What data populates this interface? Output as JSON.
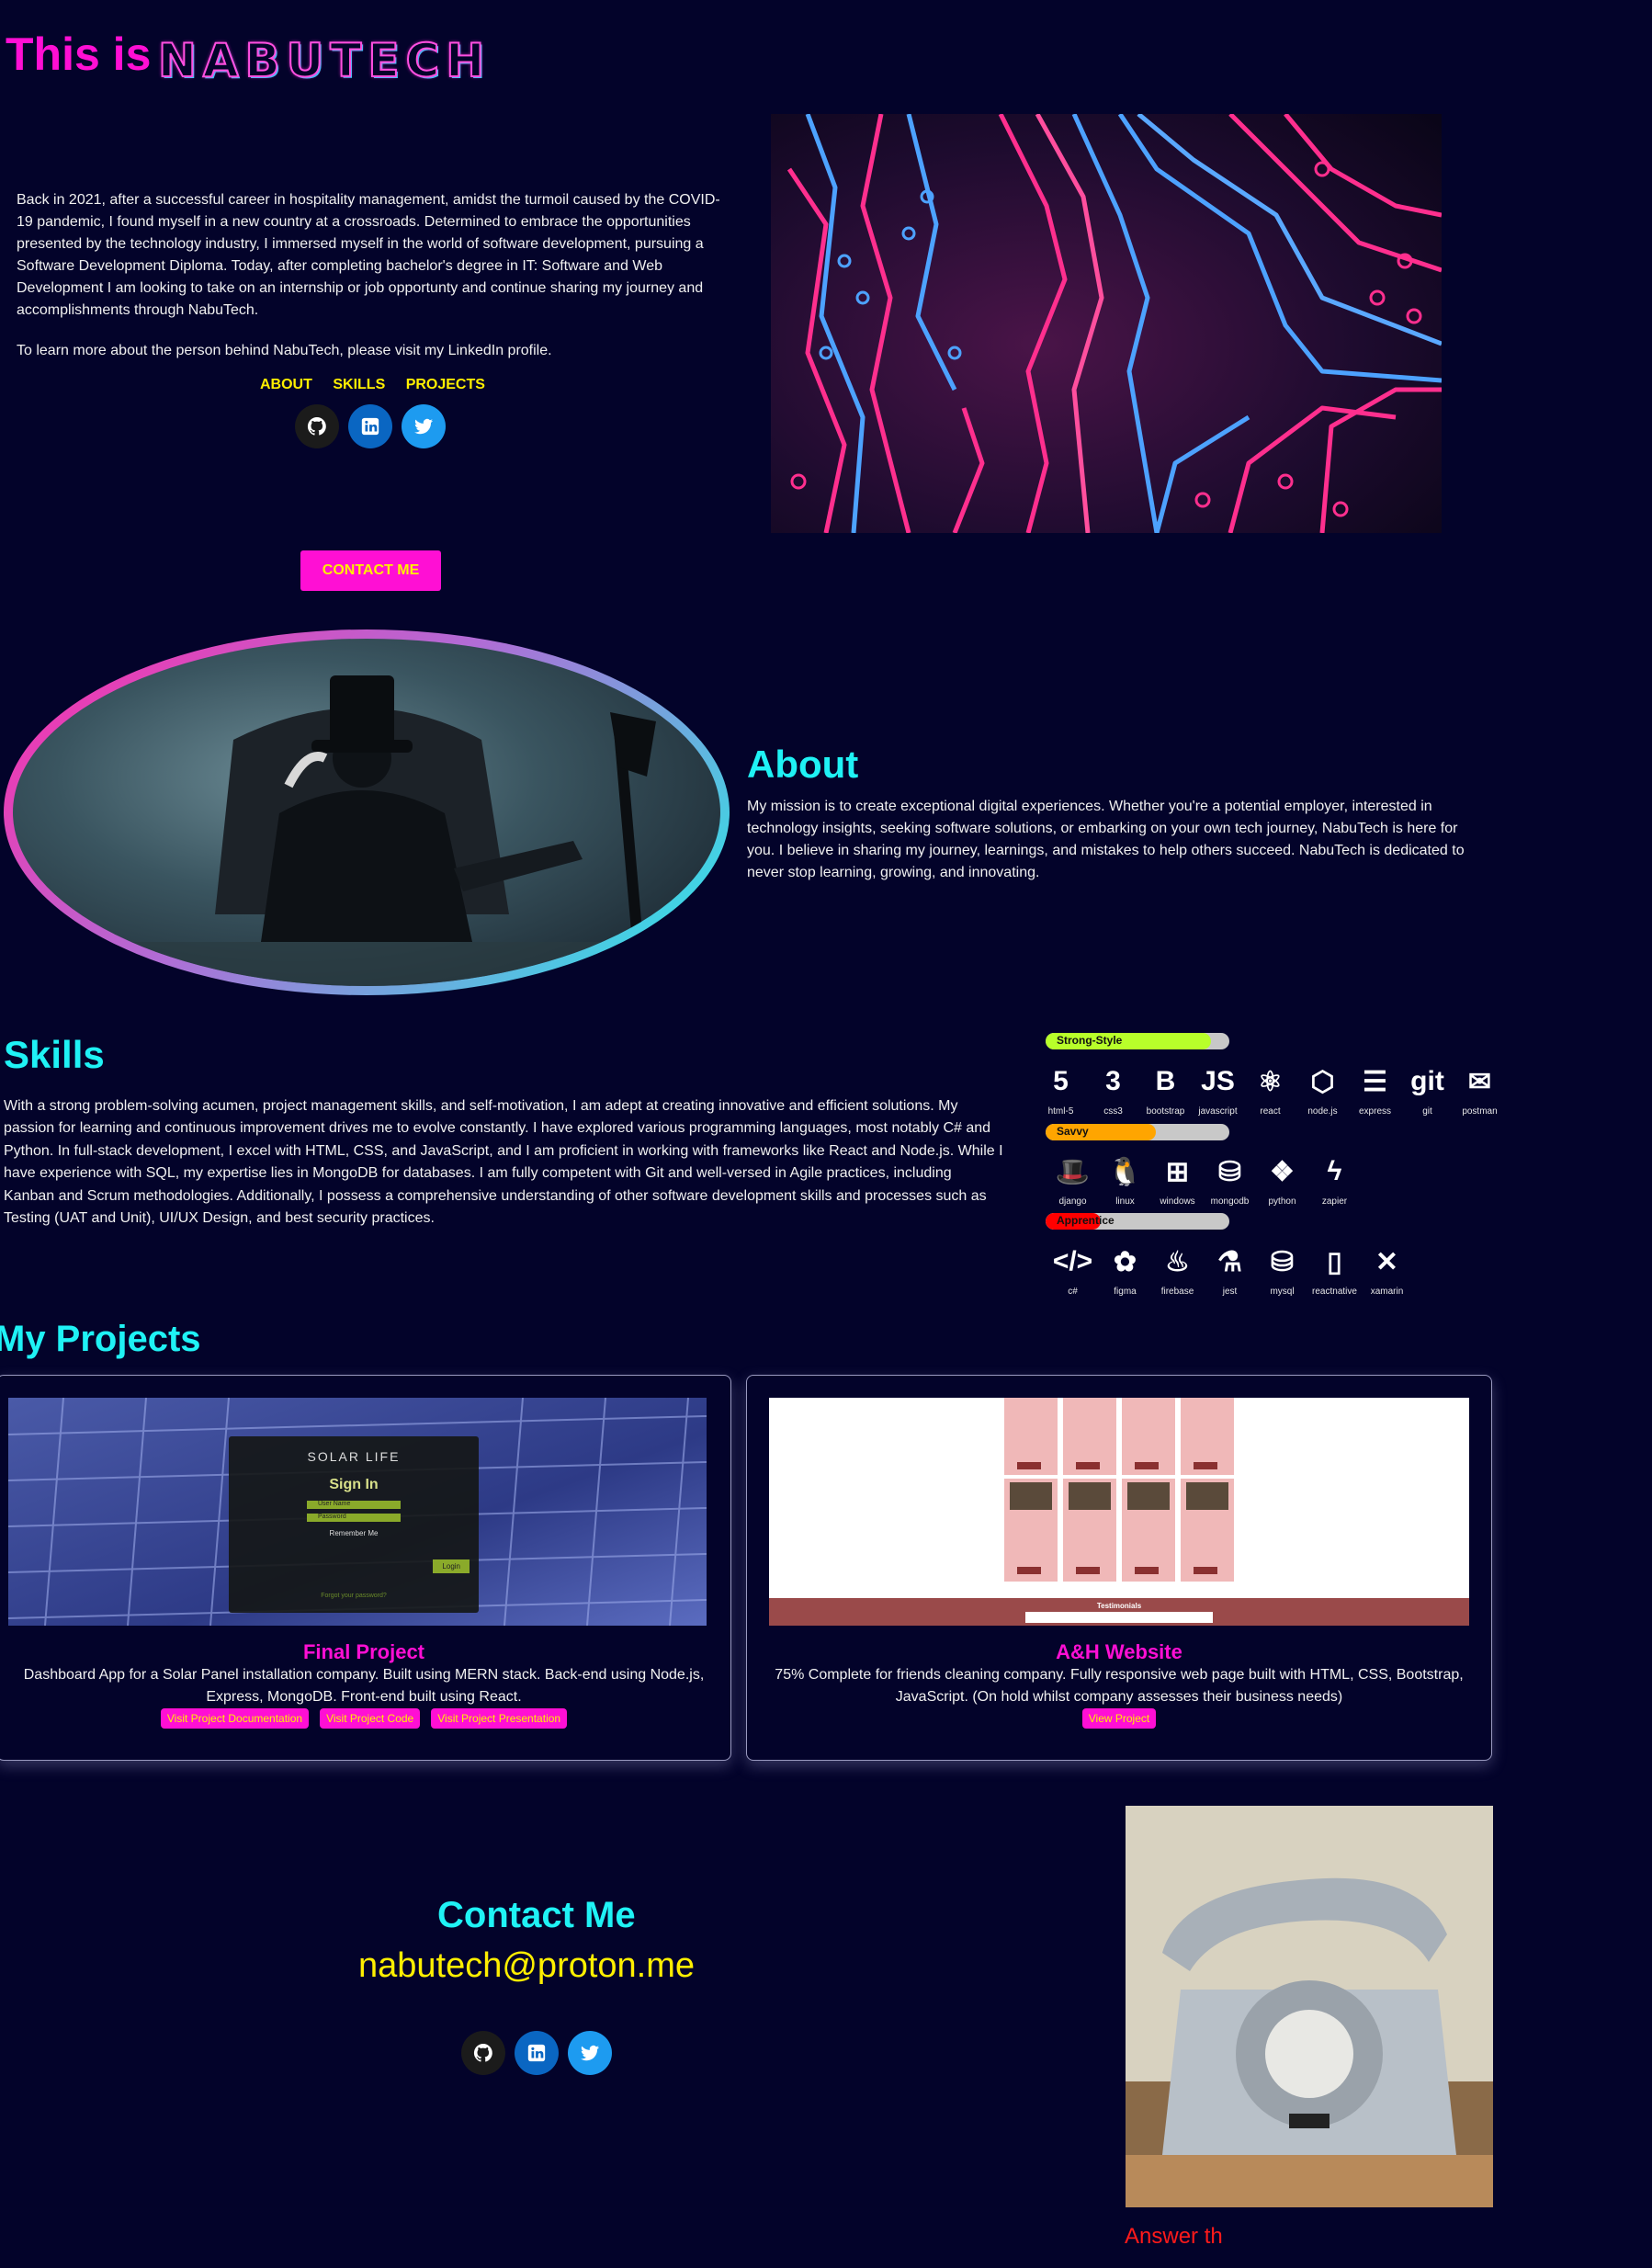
{
  "header": {
    "title_prefix": "This is",
    "brand": "NABUTECH"
  },
  "intro": {
    "paragraph1": "Back in 2021, after a successful career in hospitality management, amidst the turmoil caused by the COVID-19 pandemic, I found myself in a new country at a crossroads. Determined to embrace the opportunities presented by the technology industry, I immersed myself in the world of software development, pursuing a Software Development Diploma. Today, after completing bachelor's degree in IT: Software and Web Development I am looking to take on an internship or job opportunty and continue sharing my journey and accomplishments through NabuTech.",
    "paragraph2": "To learn more about the person behind NabuTech, please visit my LinkedIn profile."
  },
  "nav": {
    "about": "ABOUT",
    "skills": "SKILLS",
    "projects": "PROJECTS"
  },
  "contact_button": "CONTACT ME",
  "about": {
    "title": "About",
    "text": "My mission is to create exceptional digital experiences. Whether you're a potential employer, interested in technology insights, seeking software solutions, or embarking on your own tech journey, NabuTech is here for you. I believe in sharing my journey, learnings, and mistakes to help others succeed. NabuTech is dedicated to never stop learning, growing, and innovating."
  },
  "skills": {
    "title": "Skills",
    "text": "With a strong problem-solving acumen, project management skills, and self-motivation, I am adept at creating innovative and efficient solutions. My passion for learning and continuous improvement drives me to evolve constantly. I have explored various programming languages, most notably C# and Python. In full-stack development, I excel with HTML, CSS, and JavaScript, and I am proficient in working with frameworks like React and Node.js. While I have experience with SQL, my expertise lies in MongoDB for databases. I am fully competent with Git and well-versed in Agile practices, including Kanban and Scrum methodologies. Additionally, I possess a comprehensive understanding of other software development skills and processes such as Testing (UAT and Unit), UI/UX Design, and best security practices.",
    "levels": [
      {
        "label": "Strong-Style",
        "fill": 0.9,
        "color": "#b8ff2a"
      },
      {
        "label": "Savvy",
        "fill": 0.6,
        "color": "#ffa500"
      },
      {
        "label": "Apprentice",
        "fill": 0.3,
        "color": "#ff0000"
      }
    ],
    "rows": [
      [
        {
          "name": "html-5",
          "glyph": "5"
        },
        {
          "name": "css3",
          "glyph": "3"
        },
        {
          "name": "bootstrap",
          "glyph": "B"
        },
        {
          "name": "javascript",
          "glyph": "JS"
        },
        {
          "name": "react",
          "glyph": "⚛"
        },
        {
          "name": "node.js",
          "glyph": "⬡"
        },
        {
          "name": "express",
          "glyph": "☰"
        },
        {
          "name": "git",
          "glyph": "git"
        },
        {
          "name": "postman",
          "glyph": "✉"
        }
      ],
      [
        {
          "name": "django",
          "glyph": "🎩"
        },
        {
          "name": "linux",
          "glyph": "🐧"
        },
        {
          "name": "windows",
          "glyph": "⊞"
        },
        {
          "name": "mongodb",
          "glyph": "⛁"
        },
        {
          "name": "python",
          "glyph": "❖"
        },
        {
          "name": "zapier",
          "glyph": "ϟ"
        }
      ],
      [
        {
          "name": "c#",
          "glyph": "</>"
        },
        {
          "name": "figma",
          "glyph": "✿"
        },
        {
          "name": "firebase",
          "glyph": "♨"
        },
        {
          "name": "jest",
          "glyph": "⚗"
        },
        {
          "name": "mysql",
          "glyph": "⛁"
        },
        {
          "name": "reactnative",
          "glyph": "▯"
        },
        {
          "name": "xamarin",
          "glyph": "✕"
        }
      ]
    ]
  },
  "projects": {
    "title": "My Projects",
    "items": [
      {
        "title": "Final Project",
        "description": "Dashboard App for a Solar Panel installation company. Built using MERN stack. Back-end using Node.js, Express, MongoDB. Front-end built using React.",
        "buttons": [
          "Visit Project Documentation",
          "Visit Project Code",
          "Visit Project Presentation"
        ],
        "screenshot": {
          "brand": "SOLAR LIFE",
          "heading": "Sign In",
          "user_placeholder": "User Name",
          "pass_placeholder": "Password",
          "remember": "Remember Me",
          "login": "Login",
          "forgot": "Forgot your password?"
        }
      },
      {
        "title": "A&H Website",
        "description": "75% Complete for friends cleaning company. Fully responsive web page built with HTML, CSS, Bootstrap, JavaScript. (On hold whilst company assesses their business needs)",
        "buttons": [
          "View Project"
        ],
        "screenshot": {
          "testimonials": "Testimonials"
        }
      }
    ]
  },
  "contact": {
    "title": "Contact Me",
    "email": "nabutech@proton.me"
  },
  "answer_text": "Answer th",
  "colors": {
    "background": "#03032a",
    "pink": "#ff0fd4",
    "yellow": "#ffef00",
    "cyan": "#1ff2f5"
  }
}
